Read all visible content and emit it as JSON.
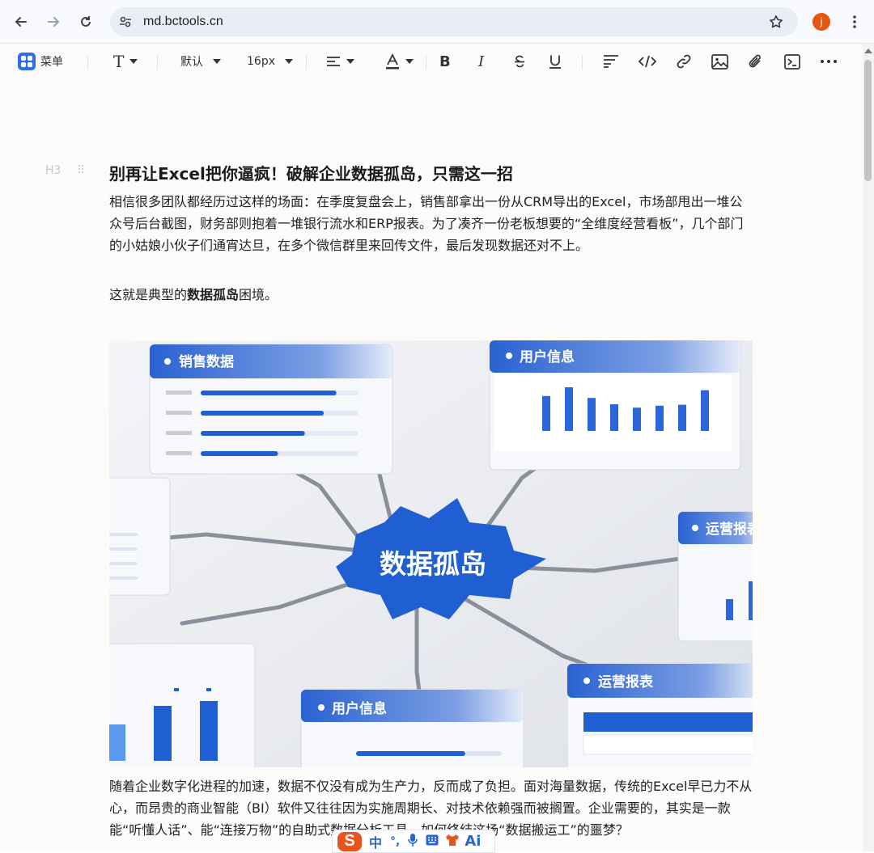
{
  "browser": {
    "url": "md.bctools.cn",
    "profile_initial": "j"
  },
  "toolbar": {
    "menu_label": "菜单",
    "font_family": "默认",
    "font_size": "16px"
  },
  "editor": {
    "heading_marker": "H3",
    "title": "别再让Excel把你逼疯！破解企业数据孤岛，只需这一招",
    "paragraph1": "相信很多团队都经历过这样的场面：在季度复盘会上，销售部拿出一份从CRM导出的Excel，市场部甩出一堆公众号后台截图，财务部则抱着一堆银行流水和ERP报表。为了凑齐一份老板想要的“全维度经营看板”，几个部门的小姑娘小伙子们通宵达旦，在多个微信群里来回传文件，最后发现数据还对不上。",
    "paragraph2_before": "这就是典型的",
    "paragraph2_bold": "数据孤岛",
    "paragraph2_after": "困境。",
    "paragraph3": "随着企业数字化进程的加速，数据不仅没有成为生产力，反而成了负担。面对海量数据，传统的Excel早已力不从心，而昂贵的商业智能（BI）软件又往往因为实施周期长、对技术依赖强而被搁置。企业需要的，其实是一款能“听懂人话”、能“连接万物”的自助式数据分析工具。如何终结这场“数据搬运工”的噩梦？"
  },
  "illustration": {
    "center_label": "数据孤岛",
    "card_sales": "销售数据",
    "card_users_top": "用户信息",
    "card_ops_right": "运营报表",
    "card_ops_bottom": "运营报表",
    "card_users_bottom": "用户信息",
    "sales_bar_levels": [
      0.86,
      0.78,
      0.66,
      0.49
    ],
    "users_bar_levels": [
      0.72,
      0.9,
      0.68,
      0.55,
      0.48,
      0.52,
      0.54,
      0.84
    ]
  },
  "ime": {
    "logo": "S",
    "mode": "中",
    "punct": "°,",
    "ai": "Ai"
  },
  "colors": {
    "accent": "#2f6fed",
    "island_blue": "#1f5fd1",
    "avatar": "#e8550f"
  }
}
